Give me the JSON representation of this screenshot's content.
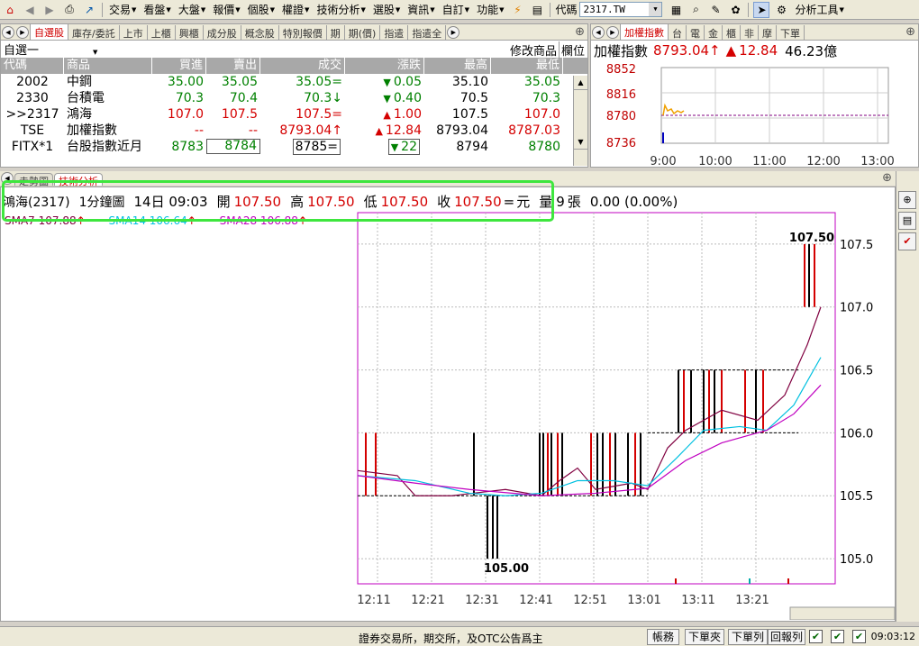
{
  "toolbar": {
    "menus": [
      "交易",
      "看盤",
      "大盤",
      "報價",
      "個股",
      "權證",
      "技術分析",
      "選股",
      "資訊",
      "自訂",
      "功能"
    ],
    "code_label": "代碼",
    "code_value": "2317.TW",
    "analysis_tools": "分析工具"
  },
  "quote": {
    "tabs": [
      "自選股",
      "庫存/委託",
      "上市",
      "上櫃",
      "興櫃",
      "成分股",
      "概念股",
      "特別報價",
      "期",
      "期(價)",
      "指遣",
      "指遣全"
    ],
    "group": "自選一",
    "modify_btn": "修改商品",
    "col_btn": "欄位",
    "headers": [
      "代碼",
      "商品",
      "買進",
      "賣出",
      "成交",
      "漲跌",
      "最高",
      "最低"
    ],
    "rows": [
      {
        "code": "2002",
        "name": "中鋼",
        "bid": "35.00",
        "ask": "35.05",
        "deal": "35.05",
        "deal_mark": "=",
        "chg_mark": "▼",
        "chg": "0.05",
        "high": "35.10",
        "low": "35.05",
        "color": "green"
      },
      {
        "code": "2330",
        "name": "台積電",
        "bid": "70.3",
        "ask": "70.4",
        "deal": "70.3",
        "deal_mark": "↓",
        "chg_mark": "▼",
        "chg": "0.40",
        "high": "70.5",
        "low": "70.3",
        "color": "green"
      },
      {
        "code": ">>2317",
        "name": "鴻海",
        "bid": "107.0",
        "ask": "107.5",
        "deal": "107.5",
        "deal_mark": "=",
        "chg_mark": "▲",
        "chg": "1.00",
        "high": "107.5",
        "low": "107.0",
        "color": "red"
      },
      {
        "code": "TSE",
        "name": "加權指數",
        "bid": "--",
        "ask": "--",
        "deal": "8793.04",
        "deal_mark": "↑",
        "chg_mark": "▲",
        "chg": "12.84",
        "high": "8793.04",
        "low": "8787.03",
        "color": "red"
      },
      {
        "code": "FITX*1",
        "name": "台股指數近月",
        "bid": "8783",
        "ask": "8784",
        "deal": "8785",
        "deal_mark": "=",
        "chg_mark": "▼",
        "chg": "22",
        "high": "8794",
        "low": "8780",
        "color": "green"
      }
    ]
  },
  "index": {
    "tabs": [
      "加權指數",
      "台",
      "電",
      "金",
      "櫃",
      "非",
      "摩",
      "下單"
    ],
    "name": "加權指數",
    "value": "8793.04",
    "value_mark": "↑",
    "change_mark": "▲",
    "change": "12.84",
    "volume": "46.23億",
    "y_ticks": [
      "8852",
      "8816",
      "8780",
      "8736"
    ],
    "x_ticks": [
      "9:00",
      "10:00",
      "11:00",
      "12:00",
      "13:00"
    ]
  },
  "chart": {
    "tabs": [
      "走勢圖",
      "技術分析"
    ],
    "stock": "鴻海(2317)",
    "period": "1分鐘圖",
    "date_time": "14日 09:03",
    "open_label": "開",
    "open": "107.50",
    "high_label": "高",
    "high": "107.50",
    "low_label": "低",
    "low": "107.50",
    "close_label": "收",
    "close": "107.50",
    "unit_mark": "=",
    "unit": "元",
    "vol_label": "量",
    "vol": "9",
    "vol_unit": "張",
    "change": "0.00 (0.00%)",
    "ma": [
      "SMA7 107.88",
      "SMA14 106.64",
      "SMA28 106.88"
    ],
    "colors": {
      "ma7": "#800040",
      "ma14": "#00c0e0",
      "ma28": "#c000c0"
    }
  },
  "chart_data": {
    "type": "bar",
    "title": "",
    "xlabel": "",
    "ylabel": "",
    "x_ticks": [
      "12:11",
      "12:21",
      "12:31",
      "12:41",
      "12:51",
      "13:01",
      "13:11",
      "13:21"
    ],
    "y_ticks": [
      "107.5",
      "107.0",
      "106.5",
      "106.0",
      "105.5",
      "105.0"
    ],
    "ylim": [
      104.8,
      107.75
    ],
    "annotations": [
      "107.50",
      "105.00"
    ]
  },
  "status": {
    "text": "證券交易所，期交所，及OTC公告爲主",
    "buttons": [
      "帳務",
      "下單夾",
      "下單列",
      "回報列"
    ],
    "time": "09:03:12"
  }
}
